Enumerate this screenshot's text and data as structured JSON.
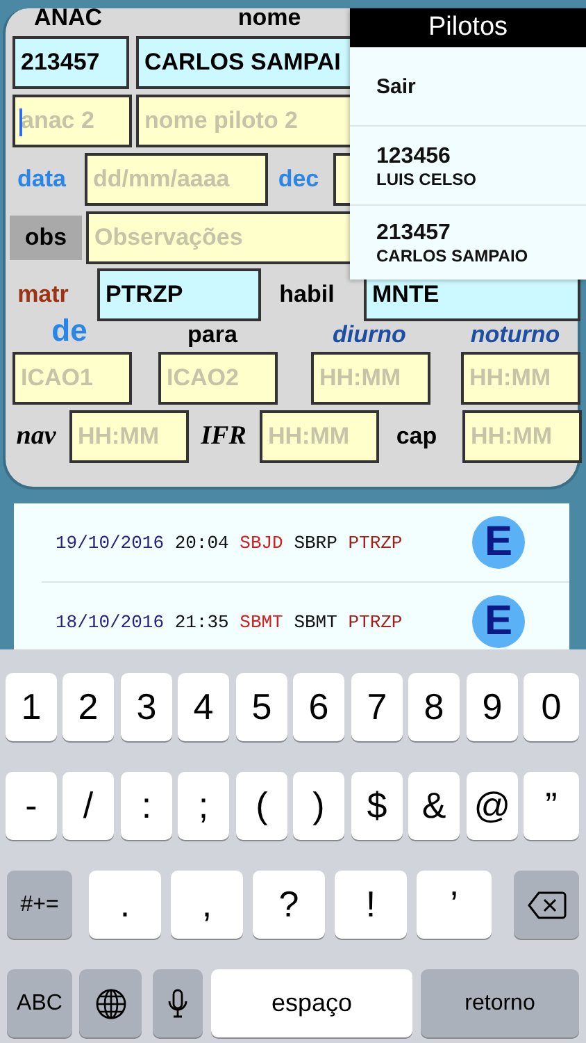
{
  "form": {
    "header": [
      {
        "text": "ANAC"
      },
      {
        "text": "nome"
      }
    ],
    "anac": {
      "value": "213457",
      "focused": false
    },
    "nome": {
      "value": "CARLOS SAMPAI",
      "focused": false
    },
    "anac_2": {
      "placeholder": "anac 2",
      "focused": true
    },
    "nome_2": {
      "placeholder": "nome piloto 2",
      "focused": false
    },
    "data_label": {
      "text": "data",
      "kind": "accent"
    },
    "data": {
      "placeholder": "dd/mm/aaaa",
      "focused": false
    },
    "dec_label": {
      "text": "dec",
      "kind": "accent"
    },
    "dec": {
      "focused": false
    },
    "obs_label": {
      "text": "obs",
      "kind": "tag"
    },
    "obs": {
      "placeholder": "Observações",
      "focused": false
    },
    "matr_label": {
      "text": "matr",
      "kind": "warm"
    },
    "matr": {
      "value": "PTRZP",
      "focused": false
    },
    "habil_label": {
      "text": "habil",
      "kind": "plain"
    },
    "habil": {
      "value": "MNTE",
      "focused": false
    },
    "route_labels": [
      {
        "text": "de",
        "kind": "big"
      },
      {
        "text": "para",
        "kind": "plain"
      },
      {
        "text": "diurno",
        "kind": "italic"
      },
      {
        "text": "noturno",
        "kind": "italic"
      }
    ],
    "route_fields": [
      {
        "placeholder": "ICAO1",
        "focused": false
      },
      {
        "placeholder": "ICAO2",
        "focused": false
      },
      {
        "placeholder": "HH:MM",
        "focused": false
      },
      {
        "placeholder": "HH:MM",
        "focused": false
      }
    ],
    "nav_label": {
      "text": "nav",
      "kind": "serif"
    },
    "nav": {
      "placeholder": "HH:MM",
      "focused": false
    },
    "ifr_label": {
      "text": "IFR",
      "kind": "serif"
    },
    "ifr": {
      "placeholder": "HH:MM",
      "focused": false
    },
    "cap_label": {
      "text": "cap",
      "kind": "plain"
    },
    "cap": {
      "placeholder": "HH:MM",
      "focused": false
    }
  },
  "pilot_menu": {
    "title": "Pilotos",
    "items": [
      {
        "kind": "action",
        "label": "Sair"
      },
      {
        "kind": "pilot",
        "anac": "123456",
        "name": "LUIS CELSO"
      },
      {
        "kind": "pilot",
        "anac": "213457",
        "name": "CARLOS SAMPAIO"
      }
    ]
  },
  "log": [
    {
      "date": "19/10/2016",
      "time": "20:04",
      "from": "SBJD",
      "to": "SBRP",
      "matr": "PTRZP",
      "button": "E"
    },
    {
      "date": "18/10/2016",
      "time": "21:35",
      "from": "SBMT",
      "to": "SBMT",
      "matr": "PTRZP",
      "button": "E"
    }
  ],
  "keyboard": {
    "digit_keys": [
      {
        "kind": "char",
        "label": "1"
      },
      {
        "kind": "char",
        "label": "2"
      },
      {
        "kind": "char",
        "label": "3"
      },
      {
        "kind": "char",
        "label": "4"
      },
      {
        "kind": "char",
        "label": "5"
      },
      {
        "kind": "char",
        "label": "6"
      },
      {
        "kind": "char",
        "label": "7"
      },
      {
        "kind": "char",
        "label": "8"
      },
      {
        "kind": "char",
        "label": "9"
      },
      {
        "kind": "char",
        "label": "0"
      }
    ],
    "symbol_keys": [
      {
        "kind": "char",
        "label": "-"
      },
      {
        "kind": "char",
        "label": "/"
      },
      {
        "kind": "char",
        "label": ":"
      },
      {
        "kind": "char",
        "label": ";"
      },
      {
        "kind": "char",
        "label": "("
      },
      {
        "kind": "char",
        "label": ")"
      },
      {
        "kind": "char",
        "label": "$"
      },
      {
        "kind": "char",
        "label": "&"
      },
      {
        "kind": "char",
        "label": "@"
      },
      {
        "kind": "char",
        "label": "”"
      }
    ],
    "punctuation_keys": [
      {
        "kind": "function",
        "label": "#+="
      },
      {
        "kind": "char",
        "label": "."
      },
      {
        "kind": "char",
        "label": ","
      },
      {
        "kind": "char",
        "label": "?"
      },
      {
        "kind": "char",
        "label": "!"
      },
      {
        "kind": "char",
        "label": "’"
      },
      {
        "kind": "backspace"
      }
    ],
    "bottom_keys": [
      {
        "kind": "function",
        "label": "ABC"
      },
      {
        "kind": "globe"
      },
      {
        "kind": "mic"
      },
      {
        "kind": "space",
        "label": "espaço"
      },
      {
        "kind": "function",
        "label": "retorno"
      }
    ]
  }
}
